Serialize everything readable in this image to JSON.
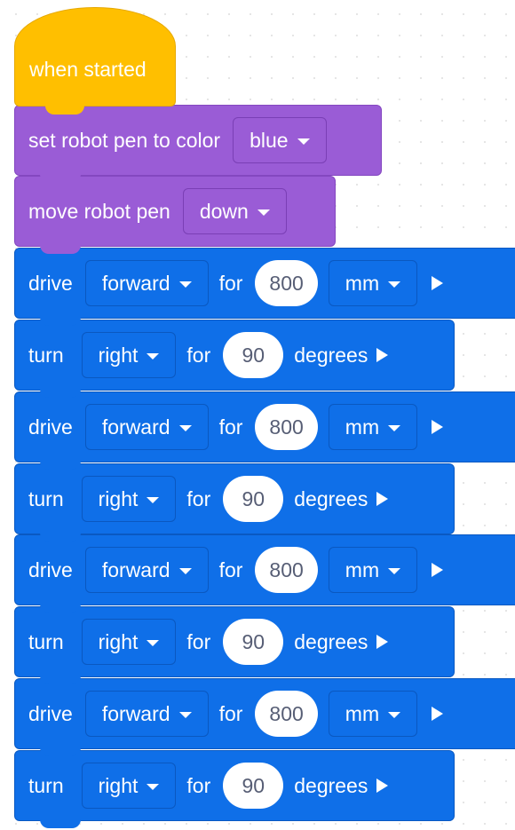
{
  "hat_block": {
    "label": "when started"
  },
  "pen_color_block": {
    "label": "set robot pen to color",
    "color_option": "blue"
  },
  "pen_move_block": {
    "label": "move robot pen",
    "position_option": "down"
  },
  "drive_blocks": [
    {
      "label": "drive",
      "direction": "forward",
      "for_label": "for",
      "distance": "800",
      "unit": "mm"
    },
    {
      "label": "drive",
      "direction": "forward",
      "for_label": "for",
      "distance": "800",
      "unit": "mm"
    },
    {
      "label": "drive",
      "direction": "forward",
      "for_label": "for",
      "distance": "800",
      "unit": "mm"
    },
    {
      "label": "drive",
      "direction": "forward",
      "for_label": "for",
      "distance": "800",
      "unit": "mm"
    }
  ],
  "turn_blocks": [
    {
      "label": "turn",
      "direction": "right",
      "for_label": "for",
      "angle": "90",
      "unit": "degrees"
    },
    {
      "label": "turn",
      "direction": "right",
      "for_label": "for",
      "angle": "90",
      "unit": "degrees"
    },
    {
      "label": "turn",
      "direction": "right",
      "for_label": "for",
      "angle": "90",
      "unit": "degrees"
    },
    {
      "label": "turn",
      "direction": "right",
      "for_label": "for",
      "angle": "90",
      "unit": "degrees"
    }
  ],
  "colors": {
    "event": "#ffbf00",
    "looks": "#9a5cd6",
    "motion": "#0f6fe8",
    "canvas": "#ffffff"
  },
  "icons": {
    "dropdown": "caret-down-icon",
    "run": "play-triangle-icon"
  }
}
